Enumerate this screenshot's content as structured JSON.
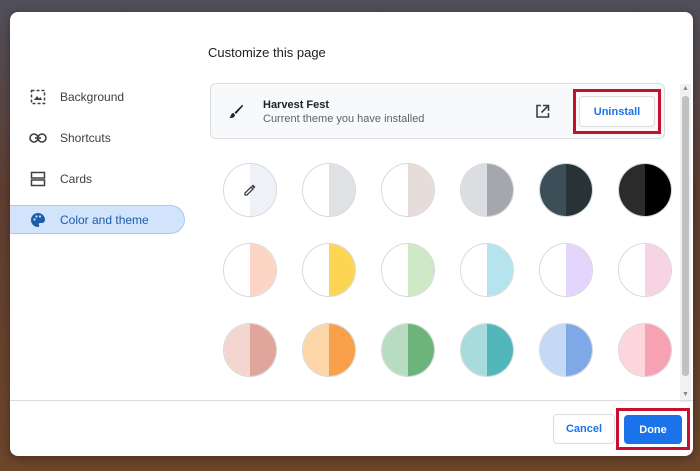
{
  "dialog": {
    "title": "Customize this page"
  },
  "sidebar": {
    "items": [
      {
        "label": "Background",
        "icon": "image-icon"
      },
      {
        "label": "Shortcuts",
        "icon": "link-icon"
      },
      {
        "label": "Cards",
        "icon": "cards-icon"
      },
      {
        "label": "Color and theme",
        "icon": "palette-icon",
        "active": true
      }
    ]
  },
  "theme": {
    "name": "Harvest Fest",
    "subtitle": "Current theme you have installed",
    "uninstall_label": "Uninstall"
  },
  "swatches": [
    {
      "picker": true,
      "left": "#ffffff",
      "right": "#eef1f6"
    },
    {
      "left": "#ffffff",
      "right": "#dfe1e5"
    },
    {
      "left": "#ffffff",
      "right": "#e6dcd9"
    },
    {
      "left": "#dcdde1",
      "right": "#a4a7ad"
    },
    {
      "left": "#3c4f59",
      "right": "#283338"
    },
    {
      "left": "#2b2b2b",
      "right": "#000000"
    },
    {
      "left": "#ffffff",
      "right": "#fdd5c4"
    },
    {
      "left": "#ffffff",
      "right": "#fbd553"
    },
    {
      "left": "#ffffff",
      "right": "#cde8c5"
    },
    {
      "left": "#ffffff",
      "right": "#b5e4ee"
    },
    {
      "left": "#ffffff",
      "right": "#e3d5fb"
    },
    {
      "left": "#ffffff",
      "right": "#f7d4e3"
    },
    {
      "left": "#f4d6d1",
      "right": "#e0a59b"
    },
    {
      "left": "#fdd6a8",
      "right": "#f8a04a"
    },
    {
      "left": "#b8dcbf",
      "right": "#6db47b"
    },
    {
      "left": "#a8dcdc",
      "right": "#52b6bb"
    },
    {
      "left": "#c4d9f5",
      "right": "#7fa9e6"
    },
    {
      "left": "#fdd6dc",
      "right": "#f7a2b2"
    },
    {
      "left": "#e8e8e8",
      "right": "#cccccc"
    },
    {
      "left": "#e8e8e8",
      "right": "#cccccc"
    },
    {
      "left": "#e8e8e8",
      "right": "#cccccc"
    },
    {
      "left": "#e8e8e8",
      "right": "#cccccc"
    },
    {
      "left": "#e8e8e8",
      "right": "#cccccc"
    },
    {
      "left": "#e8e8e8",
      "right": "#cccccc"
    }
  ],
  "footer": {
    "cancel_label": "Cancel",
    "done_label": "Done"
  },
  "colors": {
    "accent": "#1a73e8",
    "highlight": "#c8102e",
    "active_nav": "#d2e3fc"
  }
}
